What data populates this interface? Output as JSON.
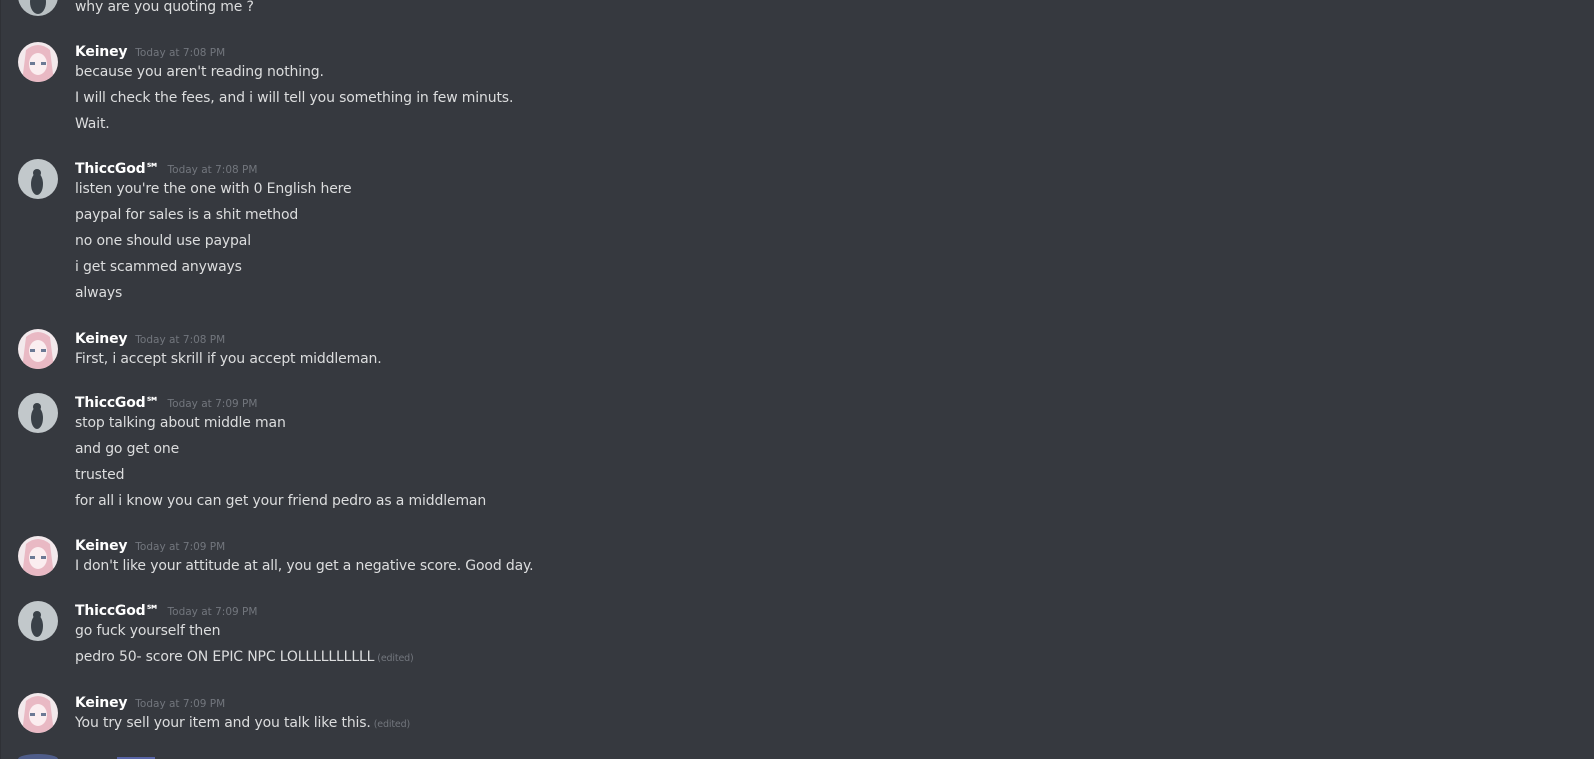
{
  "messages": {
    "top_partial": "why are you quoting me ?",
    "groups": [
      {
        "author": "Keiney",
        "time": "Today at 7:08 PM",
        "lines": [
          "because you aren't reading nothing.",
          "I will check the fees, and i will tell you something in few minuts.",
          "Wait."
        ]
      },
      {
        "author": "ThiccGod℠",
        "time": "Today at 7:08 PM",
        "lines": [
          "listen you're the one with 0 English here",
          "paypal for sales is a shit method",
          "no one should use paypal",
          "i get scammed anyways",
          "always"
        ]
      },
      {
        "author": "Keiney",
        "time": "Today at 7:08 PM",
        "lines": [
          "First, i accept skrill if you accept middleman."
        ]
      },
      {
        "author": "ThiccGod℠",
        "time": "Today at 7:09 PM",
        "lines": [
          "stop talking about middle man",
          "and go get one",
          "trusted",
          "for all i know you can get your friend pedro as a middleman"
        ]
      },
      {
        "author": "Keiney",
        "time": "Today at 7:09 PM",
        "lines": [
          "I don't like your attitude at all, you get a negative score. Good day."
        ]
      },
      {
        "author": "ThiccGod℠",
        "time": "Today at 7:09 PM",
        "lines": [
          "go fuck yourself then",
          "pedro 50- score ON EPIC NPC LOLLLLLLLLLL"
        ],
        "edited_label": "(edited)"
      },
      {
        "author": "Keiney",
        "time": "Today at 7:09 PM",
        "lines": [
          "You try sell your item and you talk like this."
        ],
        "edited_label": "(edited)"
      }
    ]
  },
  "colors": {
    "background": "#36393f",
    "username": "#ffffff",
    "text": "#dcddde",
    "muted": "#72767d"
  },
  "icons": {
    "keiney_avatar": "anime-girl-avatar-icon",
    "thiccgod_avatar": "penguin-avatar-icon"
  }
}
